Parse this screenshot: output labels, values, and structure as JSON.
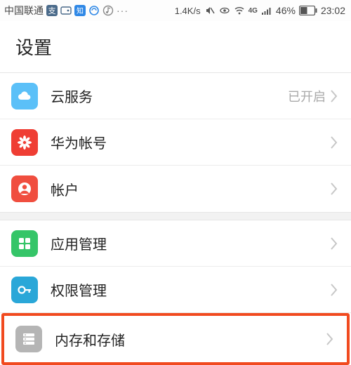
{
  "status": {
    "carrier": "中国联通",
    "icons": [
      "alipay",
      "wallet",
      "zhi",
      "cloud-sync",
      "music"
    ],
    "more": "···",
    "speed": "1.4K/s",
    "net": "4G",
    "battery_pct": "46%",
    "time": "23:02"
  },
  "header": {
    "title": "设置"
  },
  "group1": {
    "items": [
      {
        "label": "云服务",
        "value": "已开启",
        "icon": "cloud-icon"
      },
      {
        "label": "华为帐号",
        "value": "",
        "icon": "huawei-icon"
      },
      {
        "label": "帐户",
        "value": "",
        "icon": "account-icon"
      }
    ]
  },
  "group2": {
    "items": [
      {
        "label": "应用管理",
        "icon": "apps-icon"
      },
      {
        "label": "权限管理",
        "icon": "permissions-icon"
      },
      {
        "label": "内存和存储",
        "icon": "storage-icon"
      }
    ]
  }
}
